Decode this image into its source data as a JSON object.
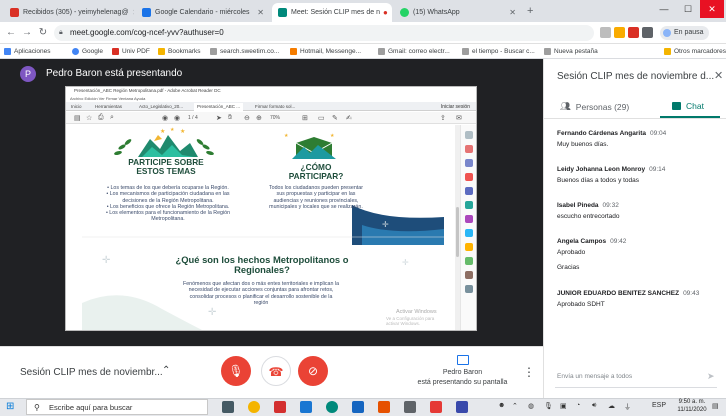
{
  "browser": {
    "tabs": [
      {
        "label": "Recibidos (305) - yeimyhelenag@",
        "color": "#d93025"
      },
      {
        "label": "Google Calendario - miércoles",
        "color": "#1a73e8"
      },
      {
        "label": "Meet: Sesión CLIP mes de n",
        "color": "#00897b"
      },
      {
        "label": "(15) WhatsApp",
        "color": "#25d366"
      }
    ],
    "url": "meet.google.com/cog-ncef-yvv?authuser=0",
    "paused_label": "En pausa",
    "bookmarks": [
      {
        "label": "Aplicaciones",
        "color": "#4285f4"
      },
      {
        "label": "Google",
        "color": "#4285f4"
      },
      {
        "label": "Univ PDF",
        "color": "#d93025"
      },
      {
        "label": "Bookmarks",
        "color": "#f4b400"
      },
      {
        "label": "search.sweetim.co...",
        "color": "#9e9e9e"
      },
      {
        "label": "Hotmail, Messenge...",
        "color": "#f57c00"
      },
      {
        "label": "Gmail: correo electr...",
        "color": "#9e9e9e"
      },
      {
        "label": "el tiempo - Buscar c...",
        "color": "#9e9e9e"
      },
      {
        "label": "Nueva pestaña",
        "color": "#9e9e9e"
      },
      {
        "label": "Otros marcadores",
        "color": "#f4b400"
      }
    ]
  },
  "meet": {
    "presenter_initial": "P",
    "presenter_title": "Pedro Baron está presentando",
    "meeting_name": "Sesión CLIP mes de noviembr...",
    "present_line1": "Pedro Baron",
    "present_line2": "está presentando su pantalla"
  },
  "shared": {
    "titlebar": "Presentación_ABC Región Metropolitana.pdf - Adobe Acrobat Reader DC",
    "menubar": "Archivo   Edición   Ver   Firmar   Ventana   Ayuda",
    "tabs": [
      "Inicio",
      "Herramientas",
      "Acto_Legislativo_20...",
      "Presentación_ABC ...",
      "Firmar formato sol..."
    ],
    "login": "Iniciar sesión",
    "zoom": "70%",
    "page_nav": "1 / 4",
    "section1_title": "PARTICIPE SOBRE ESTOS TEMAS",
    "section1_items": [
      "• Los temas de los que debería ocuparse la Región.",
      "• Los mecanismos de participación ciudadana en las decisiones de la Región Metropolitana.",
      "• Los beneficios que ofrece la Región Metropolitana.",
      "• Los elementos para el funcionamiento de la Región Metropolitana."
    ],
    "section2_title": "¿CÓMO PARTICIPAR?",
    "section2_text": "Todos los ciudadanos pueden presentar sus propuestas y participar en las audiencias y reuniones provinciales, municipales y locales que se realizarán.",
    "section3_title": "¿Qué son los hechos Metropolitanos o Regionales?",
    "section3_text": "Fenómenos que afectan dos o más entes territoriales e implican la necesidad de ejecutar acciones conjuntas para afrontar retos, consolidar procesos o planificar el desarrollo sostenible de la región",
    "watermark1": "Activar Windows",
    "watermark2": "Ve a Configuración para activar Windows."
  },
  "panel": {
    "title": "Sesión CLIP mes de noviembre d...",
    "people_label": "Personas (29)",
    "chat_label": "Chat",
    "messages": [
      {
        "sender": "Fernando Cárdenas Angarita",
        "time": "09:04",
        "text": "Muy buenos días."
      },
      {
        "sender": "Leidy Johanna Leon Monroy",
        "time": "09:14",
        "text": "Buenos días a todos y todas"
      },
      {
        "sender": "Isabel Pineda",
        "time": "09:32",
        "text": "escucho entrecortado"
      },
      {
        "sender": "Angela Campos",
        "time": "09:42",
        "text": "Aprobado",
        "text2": "Gracias"
      },
      {
        "sender": "JUNIOR EDUARDO BENITEZ SANCHEZ",
        "time": "09:43",
        "text": "Aprobado SDHT"
      }
    ],
    "input_placeholder": "Envía un mensaje a todos"
  },
  "taskbar": {
    "search_placeholder": "Escribe aquí para buscar",
    "lang": "ESP",
    "time": "9:50 a. m.",
    "date": "11/11/2020"
  },
  "colors": {
    "meet_dark": "#202124",
    "mic_off_red": "#ea4335",
    "chat_accent": "#00796b",
    "doc_green_dark": "#1e4d3b"
  }
}
